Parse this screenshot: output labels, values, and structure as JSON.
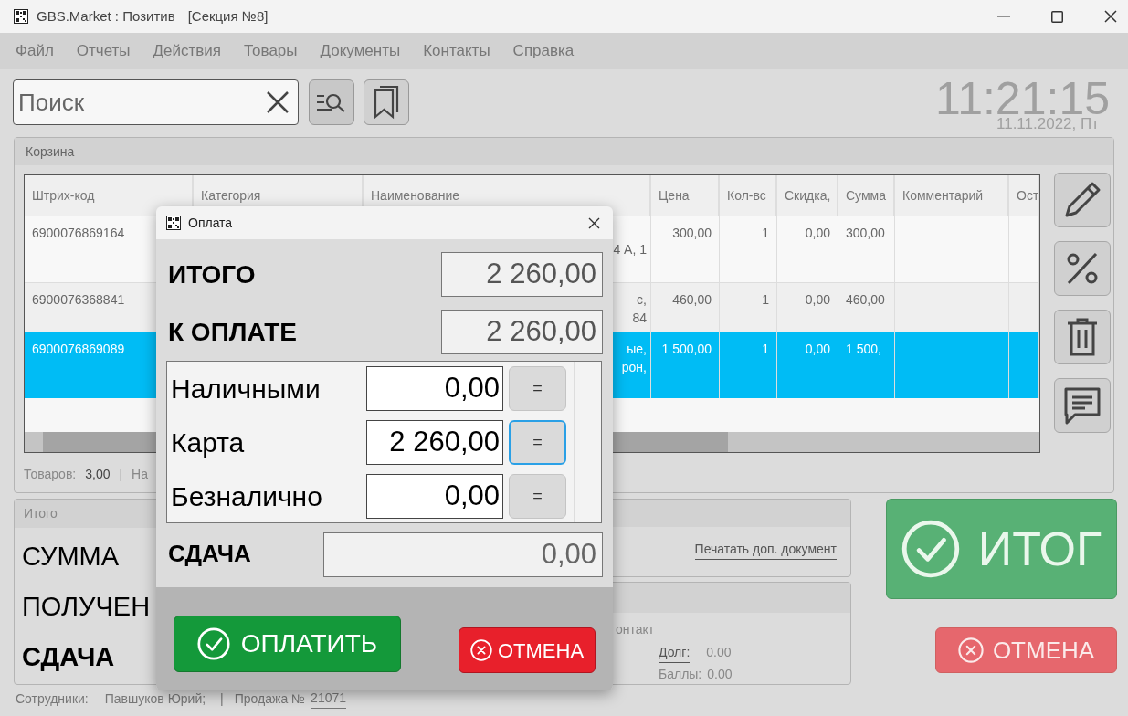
{
  "window": {
    "title": "GBS.Market : Позитив",
    "section": "[Секция №8]"
  },
  "menu": [
    "Файл",
    "Отчеты",
    "Действия",
    "Товары",
    "Документы",
    "Контакты",
    "Справка"
  ],
  "search": {
    "placeholder": "Поиск"
  },
  "clock": {
    "time": "11:21:15",
    "date": "11.11.2022, Пт"
  },
  "cart": {
    "title": "Корзина",
    "columns": [
      "Штрих-код",
      "Категория",
      "Наименование",
      "Цена",
      "Кол-вс",
      "Скидка,",
      "Сумма",
      "Комментарий",
      "Ост"
    ],
    "rows": [
      {
        "selected": false,
        "barcode": "6900076869164",
        "name_tail": [
          "4 А, 1"
        ],
        "price": "300,00",
        "qty": "1",
        "discount": "0,00",
        "sum": "300,00"
      },
      {
        "selected": false,
        "barcode": "6900076368841",
        "name_tail": [
          "с,",
          "84"
        ],
        "price": "460,00",
        "qty": "1",
        "discount": "0,00",
        "sum": "460,00"
      },
      {
        "selected": true,
        "barcode": "6900076869089",
        "name_tail": [
          "ые,",
          "рон,"
        ],
        "price": "1 500,00",
        "qty": "1",
        "discount": "0,00",
        "sum": "1 500,"
      }
    ],
    "footer": {
      "count_label": "Товаров:",
      "count": "3,00",
      "separator": "|",
      "next": "На"
    }
  },
  "totals": {
    "title": "Итого",
    "lines": [
      {
        "text": "СУММА",
        "bold": false
      },
      {
        "text": "ПОЛУЧЕН",
        "bold": false
      },
      {
        "text": "СДАЧА",
        "bold": true
      }
    ]
  },
  "print_link": "Печатать доп. документ",
  "contact": {
    "label": "онтакт",
    "debt_label": "Долг:",
    "debt": "0.00",
    "points_label": "Баллы:",
    "points": "0.00"
  },
  "total_button": "ИТОГ",
  "cancel_button": "ОТМЕНА",
  "status": {
    "staff_label": "Сотрудники:",
    "staff": "Павшуков Юрий;",
    "separator": "|",
    "sale_label": "Продажа №",
    "sale": "21071"
  },
  "dialog": {
    "title": "Оплата",
    "total_label": "ИТОГО",
    "total": "2 260,00",
    "due_label": "К ОПЛАТЕ",
    "due": "2 260,00",
    "payments": [
      {
        "label": "Наличными",
        "value": "0,00",
        "button": "=",
        "focused": false
      },
      {
        "label": "Карта",
        "value": "2 260,00",
        "button": "=",
        "focused": true
      },
      {
        "label": "Безналично",
        "value": "0,00",
        "button": "=",
        "focused": false
      }
    ],
    "change_label": "СДАЧА",
    "change": "0,00",
    "pay_button": "ОПЛАТИТЬ",
    "cancel_button": "ОТМЕНА"
  }
}
